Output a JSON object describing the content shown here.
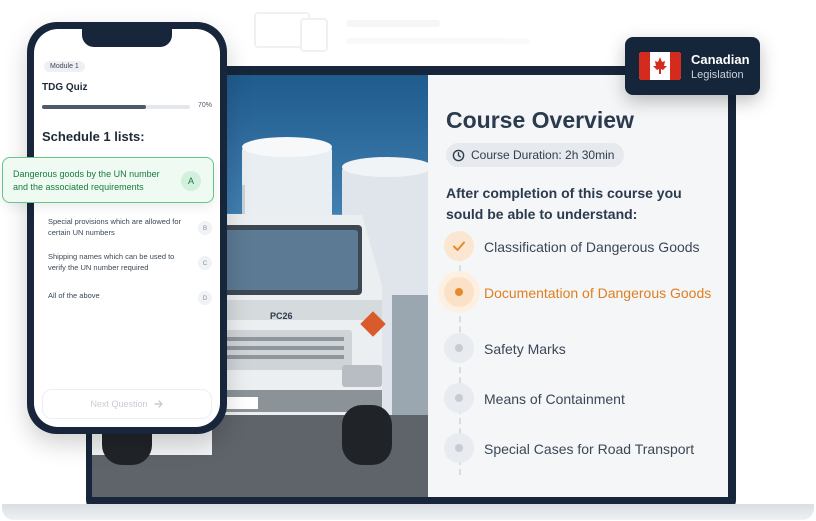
{
  "course": {
    "title": "Course Overview",
    "duration": "Course Duration: 2h 30min",
    "intro": "After completion of this course you sould be able to understand:",
    "topics": [
      {
        "label": "Classification of Dangerous Goods",
        "state": "done"
      },
      {
        "label": "Documentation of Dangerous Goods",
        "state": "active"
      },
      {
        "label": "Safety Marks",
        "state": "pending"
      },
      {
        "label": "Means of Containment",
        "state": "pending"
      },
      {
        "label": "Special Cases for Road Transport",
        "state": "pending"
      }
    ],
    "photo_truck_plate": "PC26"
  },
  "badge": {
    "title": "Canadian",
    "subtitle": "Legislation"
  },
  "quiz": {
    "module": "Module 1",
    "title": "TDG Quiz",
    "progress_label": "70%",
    "progress": 0.7,
    "question": "Schedule 1 lists:",
    "options": [
      {
        "letter": "A",
        "text": "Dangerous goods by the UN number and the associated requirements",
        "selected": true
      },
      {
        "letter": "B",
        "text": "Special provisions which are allowed for certain UN numbers",
        "selected": false
      },
      {
        "letter": "C",
        "text": "Shipping names which can be used to verify the UN number required",
        "selected": false
      },
      {
        "letter": "D",
        "text": "All of the above",
        "selected": false
      }
    ],
    "next_label": "Next Question"
  },
  "colors": {
    "accent_orange": "#e07f1f",
    "selected_green": "#197a3f",
    "navy": "#17263a"
  }
}
